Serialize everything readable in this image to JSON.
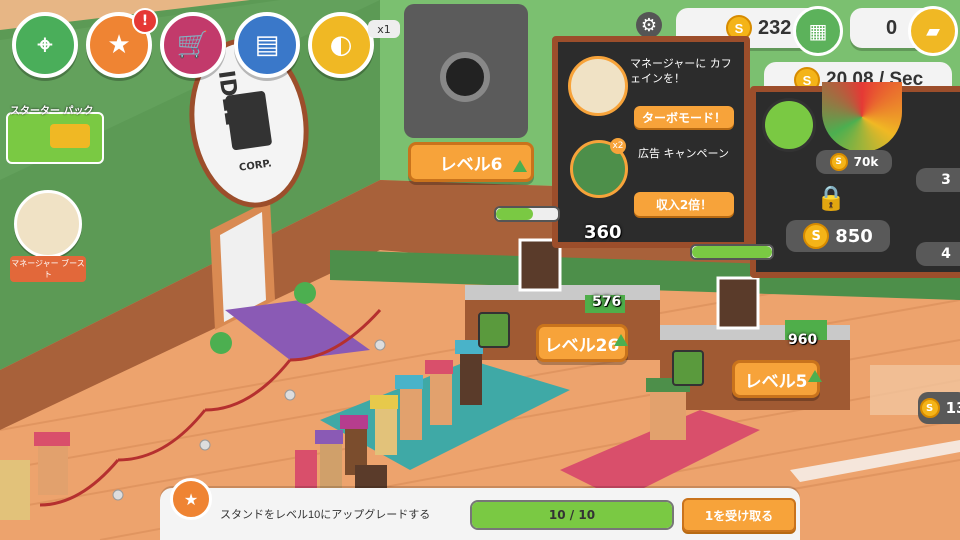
{
  "hud": {
    "multiplier_label": "x1",
    "coins_value": "232",
    "gems_value": "0",
    "income_value": "20.08 / Sec",
    "coin_symbol": "S",
    "quest_badge": "!"
  },
  "side": {
    "starter_pack_label": "スターター パック",
    "manager_boost_label": "マネージャー ブースト"
  },
  "sign": {
    "text": "IDLE",
    "corp": "CORP."
  },
  "levels": {
    "safe": "レベル6",
    "stand1": "レベル26",
    "stand2": "レベル5"
  },
  "cash_stacks": {
    "stand1_amount": "576",
    "stand1_float": "360",
    "stand2_amount": "960"
  },
  "board": {
    "manager_text": "マネージャーに カフェインを！",
    "turbo_button": "ターボモード！",
    "ad_title": "広告 キャンペーン",
    "income_button": "収入2倍！",
    "ad_badge": "x2"
  },
  "right_board": {
    "upgrade_cost_1": "70k",
    "locked_cost": "850",
    "partial_1": "3",
    "partial_2": "4",
    "partial_3": "13"
  },
  "quest": {
    "text": "スタンドをレベル10にアップグレードする",
    "progress_text": "10 / 10",
    "progress": 1.0,
    "claim_label": "1を受け取る"
  },
  "colors": {
    "wall_green": "#5c9a55",
    "floor": "#e9a06a",
    "accent_orange": "#f7a33a",
    "progress_green": "#7ac943"
  }
}
